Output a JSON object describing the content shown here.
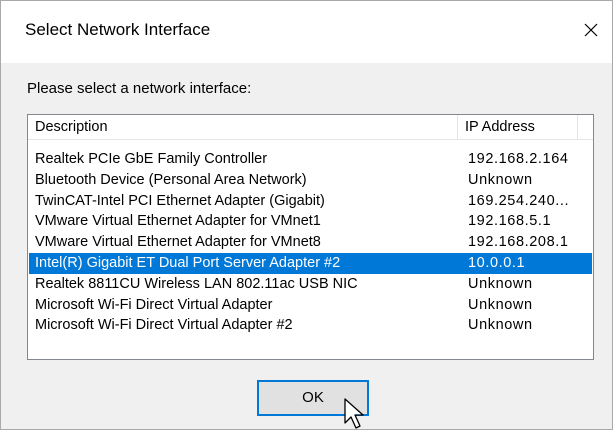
{
  "window": {
    "title": "Select Network Interface"
  },
  "prompt": "Please select a network interface:",
  "list": {
    "columns": [
      "Description",
      "IP Address"
    ],
    "rows": [
      {
        "description": "Realtek PCIe GbE Family Controller",
        "ip": "192.168.2.164",
        "selected": false
      },
      {
        "description": "Bluetooth Device (Personal Area Network)",
        "ip": "Unknown",
        "selected": false
      },
      {
        "description": "TwinCAT-Intel PCI Ethernet Adapter (Gigabit)",
        "ip": "169.254.240...",
        "selected": false
      },
      {
        "description": "VMware Virtual Ethernet Adapter for VMnet1",
        "ip": "192.168.5.1",
        "selected": false
      },
      {
        "description": "VMware Virtual Ethernet Adapter for VMnet8",
        "ip": "192.168.208.1",
        "selected": false
      },
      {
        "description": "Intel(R) Gigabit ET Dual Port Server Adapter #2",
        "ip": "10.0.0.1",
        "selected": true
      },
      {
        "description": "Realtek 8811CU Wireless LAN 802.11ac USB NIC",
        "ip": "Unknown",
        "selected": false
      },
      {
        "description": "Microsoft Wi-Fi Direct Virtual Adapter",
        "ip": "Unknown",
        "selected": false
      },
      {
        "description": "Microsoft Wi-Fi Direct Virtual Adapter #2",
        "ip": "Unknown",
        "selected": false
      }
    ]
  },
  "buttons": {
    "ok_label": "OK"
  },
  "icons": {
    "close": "close-icon",
    "cursor": "mouse-cursor-icon"
  },
  "colors": {
    "selection": "#0078d7",
    "selection_text": "#ffffff",
    "button_border_focus": "#0078d7"
  }
}
